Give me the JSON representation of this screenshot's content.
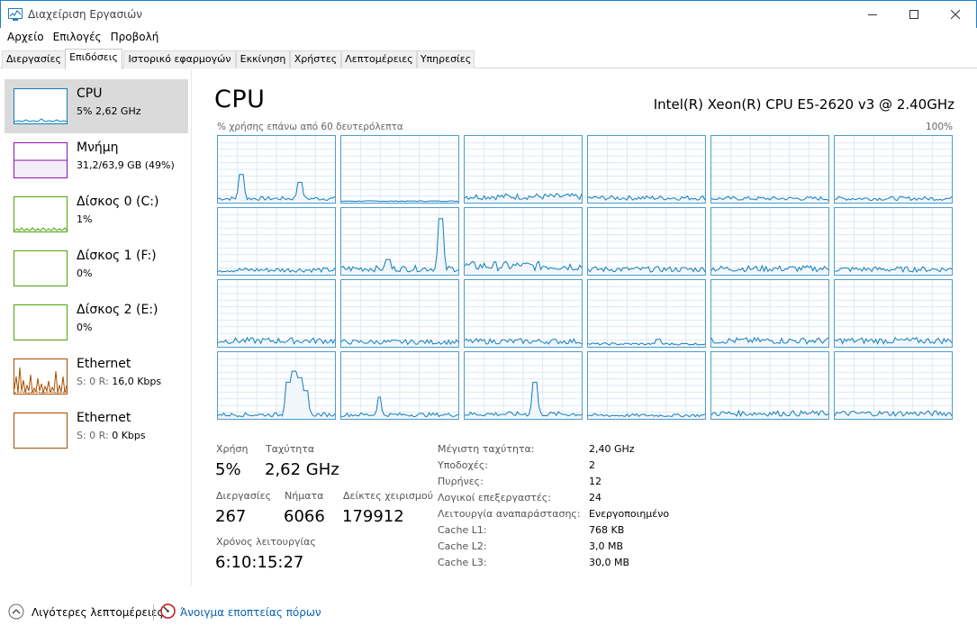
{
  "window": {
    "title": "Διαχείριση Εργασιών"
  },
  "menu": [
    "Αρχείο",
    "Επιλογές",
    "Προβολή"
  ],
  "tabs": [
    "Διεργασίες",
    "Επιδόσεις",
    "Ιστορικό εφαρμογών",
    "Εκκίνηση",
    "Χρήστες",
    "Λεπτομέρειες",
    "Υπηρεσίες"
  ],
  "active_tab": "Επιδόσεις",
  "sidebar": [
    {
      "title": "CPU",
      "sub": "5% 2,62 GHz",
      "color": "#117dbb"
    },
    {
      "title": "Μνήμη",
      "sub": "31,2/63,9 GB (49%)",
      "color": "#8b12ae",
      "fill": 0.49
    },
    {
      "title": "Δίσκος 0 (C:)",
      "sub": "1%",
      "color": "#4da60c"
    },
    {
      "title": "Δίσκος 1 (F:)",
      "sub": "0%",
      "color": "#4da60c"
    },
    {
      "title": "Δίσκος 2 (E:)",
      "sub": "0%",
      "color": "#4da60c"
    },
    {
      "title": "Ethernet",
      "sub": "S: 0 R: 16,0 Kbps",
      "sub_prefix": "S: 0 R:",
      "sub_value": "16,0 Kbps",
      "color": "#a74f01"
    },
    {
      "title": "Ethernet",
      "sub": "S: 0 R: 0 Kbps",
      "sub_prefix": "S: 0 R:",
      "sub_value": "0 Kbps",
      "color": "#a74f01"
    }
  ],
  "cpu": {
    "heading": "CPU",
    "model": "Intel(R) Xeon(R) CPU E5-2620 v3 @ 2.40GHz",
    "graph_label": "% χρήσης επάνω από 60 δευτερόλεπτα",
    "graph_max": "100%",
    "graph_color": "#117dbb",
    "stats": {
      "usage_label": "Χρήση",
      "usage": "5%",
      "speed_label": "Ταχύτητα",
      "speed": "2,62 GHz",
      "processes_label": "Διεργασίες",
      "processes": "267",
      "threads_label": "Νήματα",
      "threads": "6066",
      "handles_label": "Δείκτες χειρισμού",
      "handles": "179912",
      "uptime_label": "Χρόνος λειτουργίας",
      "uptime": "6:10:15:27"
    },
    "specs": [
      {
        "label": "Μέγιστη ταχύτητα:",
        "value": "2,40 GHz"
      },
      {
        "label": "Υποδοχές:",
        "value": "2"
      },
      {
        "label": "Πυρήνες:",
        "value": "12"
      },
      {
        "label": "Λογικοί επεξεργαστές:",
        "value": "24"
      },
      {
        "label": "Λειτουργία αναπαράστασης:",
        "value": "Ενεργοποιημένο"
      },
      {
        "label": "Cache L1:",
        "value": "768 KB"
      },
      {
        "label": "Cache L2:",
        "value": "3,0 MB"
      },
      {
        "label": "Cache L3:",
        "value": "30,0 MB"
      }
    ]
  },
  "footer": {
    "fewer_details": "Λιγότερες λεπτομέρειες",
    "resource_monitor": "Άνοιγμα εποπτείας πόρων"
  }
}
